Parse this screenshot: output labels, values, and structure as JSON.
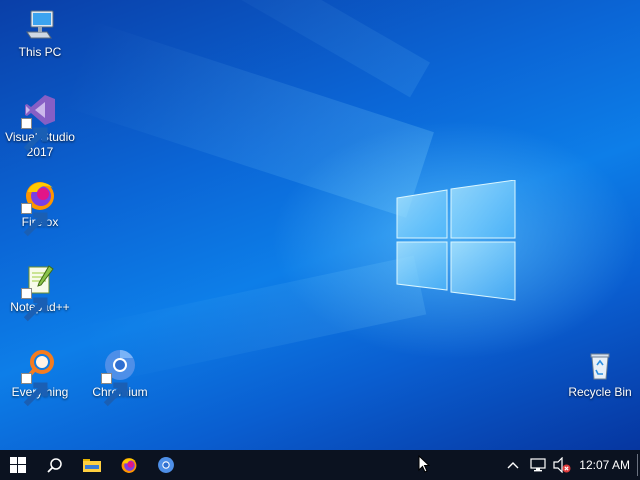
{
  "desktop": {
    "icons": [
      {
        "label": "This PC",
        "icon": "computer-icon"
      },
      {
        "label": "Visual Studio 2017",
        "icon": "visual-studio-icon"
      },
      {
        "label": "Firefox",
        "icon": "firefox-icon"
      },
      {
        "label": "Notepad++",
        "icon": "notepad-plus-plus-icon"
      },
      {
        "label": "Everything",
        "icon": "everything-search-icon"
      },
      {
        "label": "Chromium",
        "icon": "chromium-icon"
      },
      {
        "label": "Recycle Bin",
        "icon": "recycle-bin-icon"
      }
    ]
  },
  "taskbar": {
    "pinned": [
      "start-icon",
      "search-icon",
      "file-explorer-icon",
      "firefox-icon",
      "chromium-icon"
    ],
    "tray": [
      "chevron-up-icon",
      "network-icon",
      "volume-muted-icon"
    ],
    "clock": "12:07 AM"
  },
  "colors": {
    "taskbar": "#0b1220",
    "desktop_blue": "#0b66d6"
  }
}
